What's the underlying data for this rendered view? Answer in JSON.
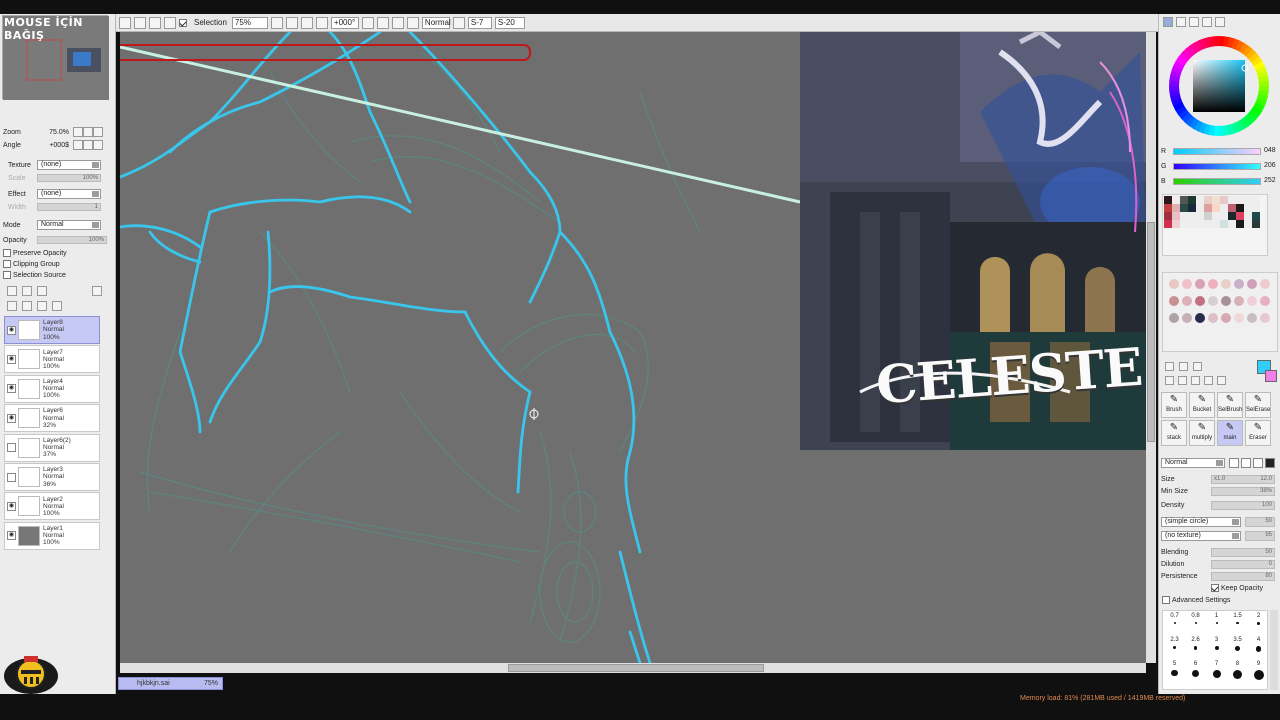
{
  "brand": {
    "text": "MOUSE İÇİN BAĞIŞ"
  },
  "toolbar": {
    "selection_label": "Selection",
    "zoom": "75%",
    "angle": "+000°",
    "mode": "Normal",
    "stabilizer": "S-7",
    "stab_value": "S-20"
  },
  "navigator": {
    "zoom_label": "Zoom",
    "zoom_value": "75.0%",
    "angle_label": "Angle",
    "angle_value": "+000$"
  },
  "properties": {
    "texture_label": "Texture",
    "texture_value": "(none)",
    "scale_label": "Scale",
    "scale_value": "100%",
    "effect_label": "Effect",
    "effect_value": "(none)",
    "width_label": "Width",
    "width_value": "1",
    "mode_label": "Mode",
    "mode_value": "Normal",
    "opacity_label": "Opacity",
    "opacity_value": "100%",
    "preserve_opacity": "Preserve Opacity",
    "clipping_group": "Clipping Group",
    "selection_source": "Selection Source"
  },
  "layers": [
    {
      "name": "Layer8",
      "mode": "Normal",
      "opacity": "100%",
      "active": true,
      "visible": true
    },
    {
      "name": "Layer7",
      "mode": "Normal",
      "opacity": "100%",
      "visible": true
    },
    {
      "name": "Layer4",
      "mode": "Normal",
      "opacity": "100%",
      "visible": true
    },
    {
      "name": "Layer6",
      "mode": "Normal",
      "opacity": "32%",
      "visible": true
    },
    {
      "name": "Layer6(2)",
      "mode": "Normal",
      "opacity": "37%",
      "visible": false
    },
    {
      "name": "Layer3",
      "mode": "Normal",
      "opacity": "36%",
      "visible": false
    },
    {
      "name": "Layer2",
      "mode": "Normal",
      "opacity": "100%",
      "visible": true
    },
    {
      "name": "Layer1",
      "mode": "Normal",
      "opacity": "100%",
      "visible": true
    }
  ],
  "file_tab": {
    "name": "hjkbkjn.sai",
    "zoom": "75%"
  },
  "reference": {
    "title": "CELESTE"
  },
  "color": {
    "r_label": "R",
    "r_value": "048",
    "g_label": "G",
    "g_value": "206",
    "b_label": "B",
    "b_value": "252",
    "current": "#30cefc"
  },
  "tools": [
    "Brush",
    "Bucket",
    "SelBrush",
    "SelErase",
    "stack",
    "multiply",
    "main",
    "Eraser"
  ],
  "brush": {
    "mode": "Normal",
    "size_label": "Size",
    "size_mult": "x1.0",
    "size_value": "12.0",
    "minsize_label": "Min Size",
    "minsize_value": "38%",
    "density_label": "Density",
    "density_value": "100",
    "shape": "(simple circle)",
    "shape_value": "50",
    "texture": "(no texture)",
    "texture_value": "95",
    "blending_label": "Blending",
    "blending_value": "50",
    "dilution_label": "Dilution",
    "dilution_value": "0",
    "persistence_label": "Persistence",
    "persistence_value": "80",
    "keep_opacity": "Keep Opacity",
    "advanced": "Advanced Settings"
  },
  "brush_sizes": [
    "0.7",
    "0.8",
    "1",
    "1.5",
    "2",
    "2.3",
    "2.6",
    "3",
    "3.5",
    "4",
    "5",
    "6",
    "7",
    "8",
    "9"
  ],
  "status": {
    "memory": "Memory load: 81% (281MB used / 1419MB reserved)"
  }
}
